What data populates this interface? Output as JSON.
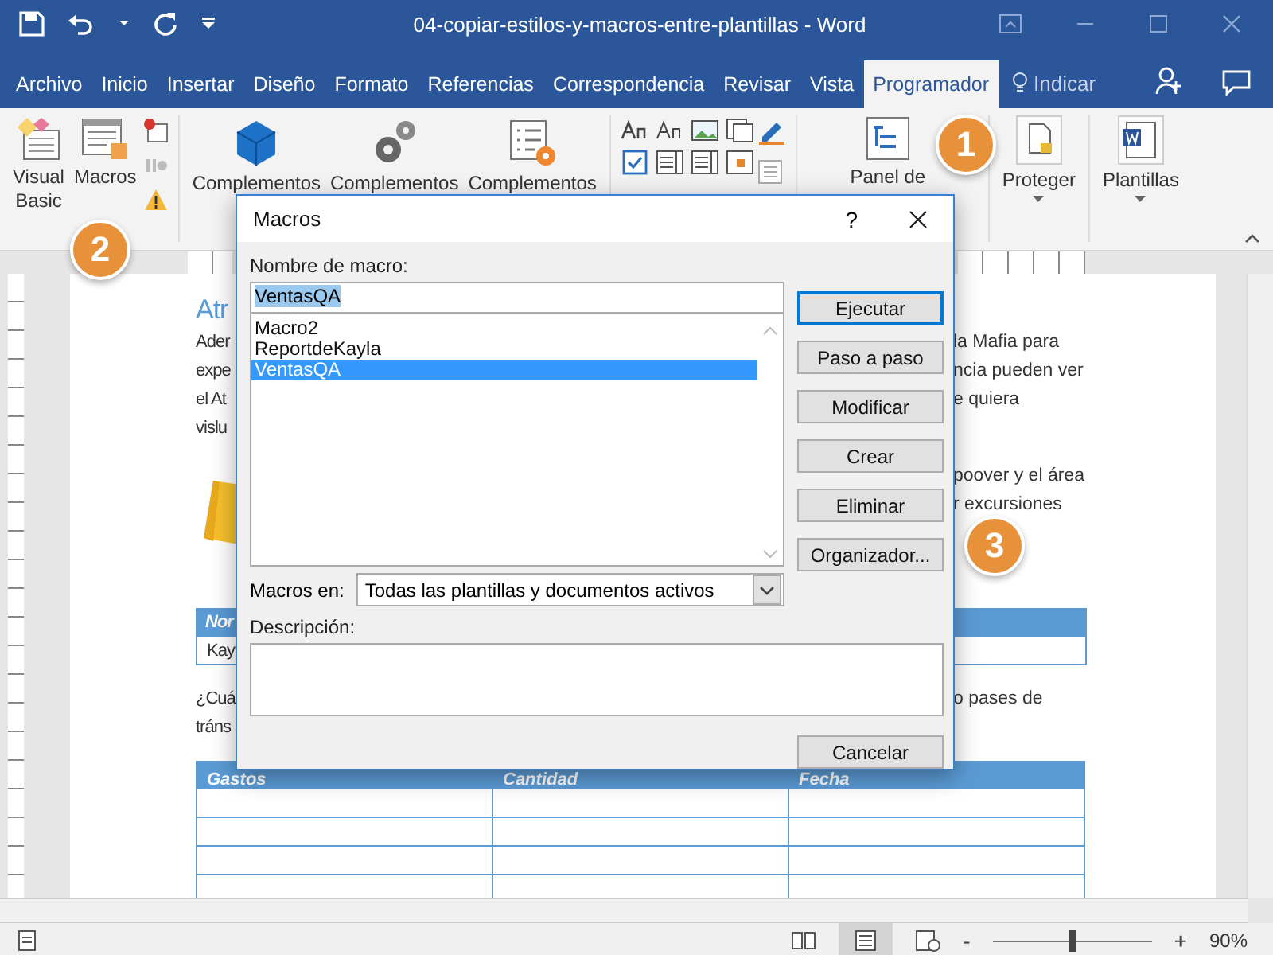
{
  "window": {
    "title": "04-copiar-estilos-y-macros-entre-plantillas  -  Word"
  },
  "tabs": [
    {
      "label": "Archivo",
      "selected": false
    },
    {
      "label": "Inicio",
      "selected": false
    },
    {
      "label": "Insertar",
      "selected": false
    },
    {
      "label": "Diseño",
      "selected": false
    },
    {
      "label": "Formato",
      "selected": false
    },
    {
      "label": "Referencias",
      "selected": false
    },
    {
      "label": "Correspondencia",
      "selected": false
    },
    {
      "label": "Revisar",
      "selected": false
    },
    {
      "label": "Vista",
      "selected": false
    },
    {
      "label": "Programador",
      "selected": true
    }
  ],
  "tell_me": "Indicar",
  "ribbon": {
    "visual_basic": [
      "Visual",
      "Basic"
    ],
    "macros": "Macros",
    "complementos": [
      "Complementos",
      "Complementos",
      "Complementos"
    ],
    "panel": "Panel de",
    "proteger": "Proteger",
    "plantillas": "Plantillas"
  },
  "dialog": {
    "title": "Macros",
    "help": "?",
    "name_label": "Nombre de macro:",
    "name_value": "VentasQA",
    "macros": [
      {
        "name": "Macro2",
        "selected": false
      },
      {
        "name": "ReportdeKayla",
        "selected": false
      },
      {
        "name": "VentasQA",
        "selected": true
      }
    ],
    "buttons": [
      {
        "label": "Ejecutar",
        "default": true
      },
      {
        "label": "Paso a paso",
        "default": false
      },
      {
        "label": "Modificar",
        "default": false
      },
      {
        "label": "Crear",
        "default": false
      },
      {
        "label": "Eliminar",
        "default": false
      },
      {
        "label": "Organizador...",
        "default": false
      }
    ],
    "macros_in_label": "Macros en:",
    "macros_in_value": "Todas las plantillas y documentos activos",
    "description_label": "Descripción:",
    "cancel": "Cancelar"
  },
  "document": {
    "lines": [
      {
        "kind": "heading",
        "left": "Atr"
      },
      {
        "kind": "text",
        "left": "Ader",
        "right": "la Mafia para"
      },
      {
        "kind": "text",
        "left": "expe",
        "right": "ncia pueden ver"
      },
      {
        "kind": "text",
        "left": "el At",
        "right": "e quiera"
      },
      {
        "kind": "text",
        "left": "vislu"
      },
      {
        "kind": "gap_small"
      },
      {
        "kind": "text",
        "right": "poover y el área"
      },
      {
        "kind": "text",
        "right": "r excursiones"
      },
      {
        "kind": "gap"
      },
      {
        "kind": "gap"
      },
      {
        "kind": "table_head",
        "left": "Nor"
      },
      {
        "kind": "table_row",
        "left": "Kay"
      },
      {
        "kind": "gap_small"
      },
      {
        "kind": "text",
        "left": "¿Cuá",
        "right": "o pases de"
      },
      {
        "kind": "text",
        "left": "tráns"
      }
    ],
    "table": {
      "columns": [
        "Gastos",
        "Cantidad",
        "Fecha"
      ]
    }
  },
  "callouts": [
    "1",
    "2",
    "3"
  ],
  "status": {
    "zoom": "90%",
    "level": 0.5,
    "minus": "-",
    "plus": "+"
  }
}
